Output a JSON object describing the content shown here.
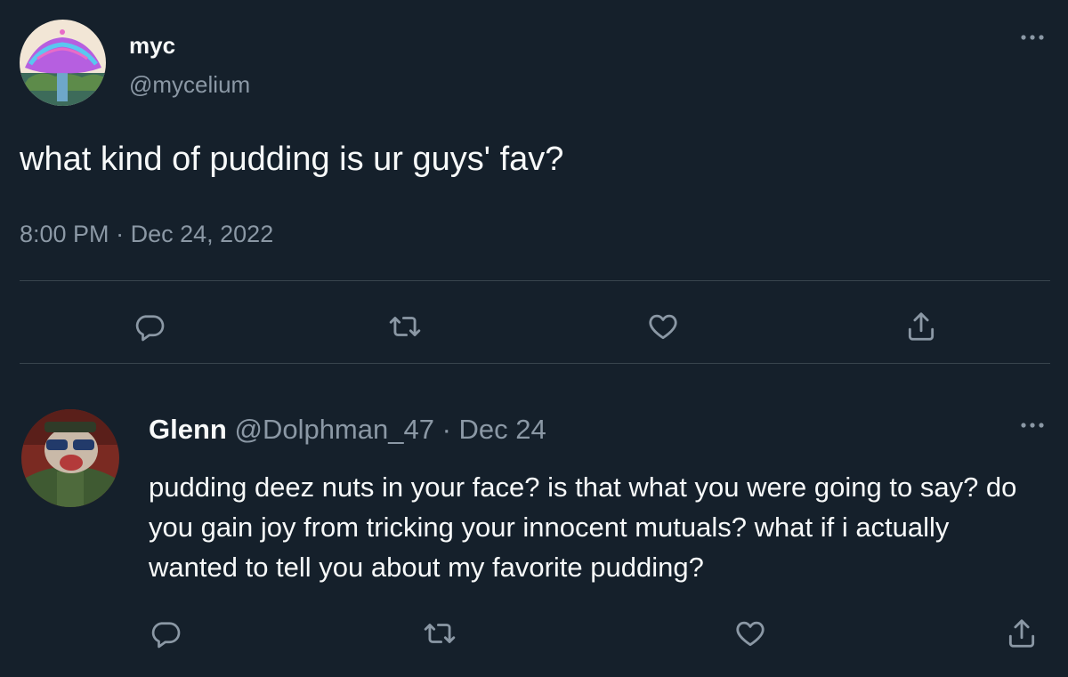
{
  "main_tweet": {
    "display_name": "myc",
    "handle": "@mycelium",
    "text": "what kind of pudding is ur guys' fav?",
    "time": "8:00 PM",
    "separator": "·",
    "date": "Dec 24, 2022"
  },
  "reply": {
    "display_name": "Glenn",
    "handle": "@Dolphman_47",
    "separator": "·",
    "date": "Dec 24",
    "text": "pudding deez nuts in your face? is that what you were going to say? do you gain joy from tricking your innocent mutuals? what if i actually wanted to tell you about my favorite pudding?"
  },
  "colors": {
    "background": "#15202b",
    "text": "#f7f9f9",
    "muted": "#8b98a5",
    "divider": "#38444d"
  },
  "icons": {
    "reply": "reply-icon",
    "retweet": "retweet-icon",
    "like": "heart-icon",
    "share": "share-icon",
    "more": "more-icon"
  }
}
